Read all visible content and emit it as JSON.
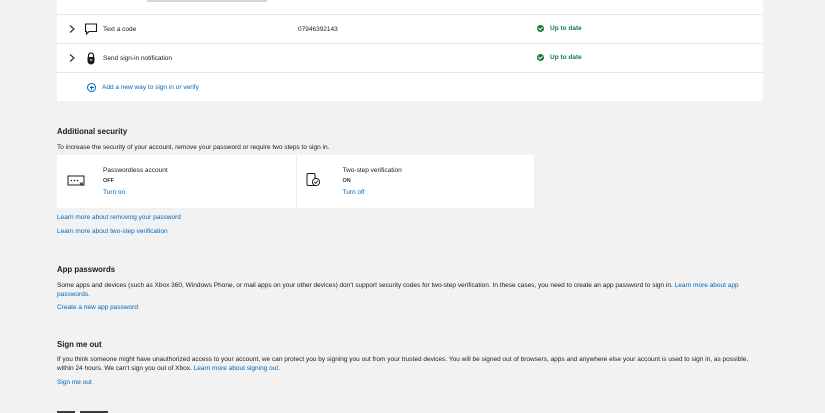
{
  "methods": {
    "rows": [
      {
        "label": "Text a code",
        "value": "07946392143",
        "status": "Up to date",
        "icon": "chat-icon"
      },
      {
        "label": "Send sign-in notification",
        "value": "",
        "status": "Up to date",
        "icon": "lock-icon"
      }
    ],
    "add_link": "Add a new way to sign in or verify"
  },
  "additional_security": {
    "title": "Additional security",
    "description": "To increase the security of your account, remove your password or require two steps to sign in.",
    "passwordless": {
      "name": "Passwordless account",
      "state": "OFF",
      "action": "Turn on",
      "icon": "password-icon"
    },
    "two_step": {
      "name": "Two-step verification",
      "state": "ON",
      "action": "Turn off",
      "icon": "phone-check-icon"
    },
    "link_remove_password": "Learn more about removing your password",
    "link_two_step": "Learn more about two-step verification"
  },
  "app_passwords": {
    "title": "App passwords",
    "description": "Some apps and devices (such as Xbox 360, Windows Phone, or mail apps on your other devices) don't support security codes for two-step verification. In these cases, you need to create an app password to sign in.",
    "learn_more": "Learn more about app passwords.",
    "create_link": "Create a new app password"
  },
  "sign_me_out": {
    "title": "Sign me out",
    "description": "If you think someone might have unauthorized access to your account, we can protect you by signing you out from your trusted devices. You will be signed out of browsers, apps and anywhere else your account is used to sign in, as possible, within 24 hours. We can't sign you out of Xbox.",
    "learn_more": "Learn more about signing out.",
    "action": "Sign me out"
  },
  "colors": {
    "accent": "#0067b8",
    "success": "#107c41",
    "background": "#f2f2f2"
  }
}
